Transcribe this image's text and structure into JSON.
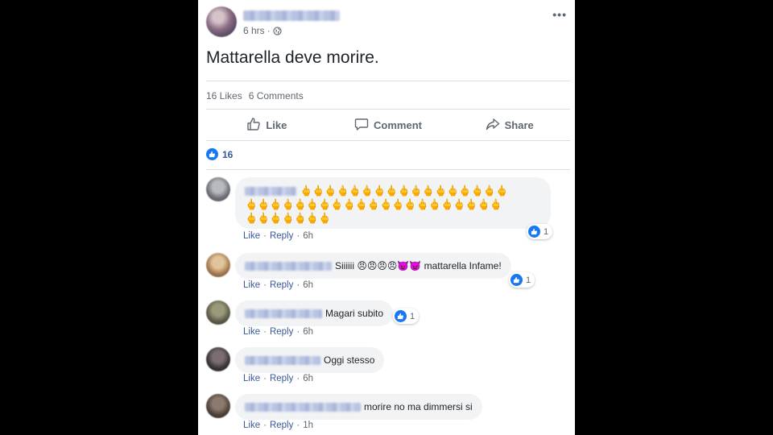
{
  "post": {
    "timestamp": "6 hrs",
    "separator": "·",
    "more_label": "•••",
    "text": "Mattarella deve morire.",
    "likes": "16 Likes",
    "comments_count": "6 Comments",
    "actions": {
      "like": "Like",
      "comment": "Comment",
      "share": "Share"
    },
    "reaction_total": "16",
    "colors": {
      "link": "#385898",
      "like_blue": "#1877f2",
      "bubble": "#f2f3f5",
      "meta": "#606770"
    }
  },
  "comments": [
    {
      "emoji_line1": "🖕🖕🖕🖕🖕🖕🖕🖕🖕🖕🖕🖕🖕🖕🖕🖕🖕",
      "emoji_line2": "🖕🖕🖕🖕🖕🖕🖕🖕🖕🖕🖕🖕🖕🖕🖕🖕🖕🖕🖕🖕🖕",
      "emoji_line3": "🖕🖕🖕🖕🖕🖕🖕",
      "like": "Like",
      "reply": "Reply",
      "time": "6h",
      "reactions": "1"
    },
    {
      "text_prefix": "Siiiiii",
      "emojis": "😠😠😠😠👿👿",
      "text_suffix": "mattarella Infame!",
      "like": "Like",
      "reply": "Reply",
      "time": "6h",
      "reactions": "1"
    },
    {
      "text": "Magari subito",
      "like": "Like",
      "reply": "Reply",
      "time": "6h",
      "reactions": "1"
    },
    {
      "text": "Oggi stesso",
      "like": "Like",
      "reply": "Reply",
      "time": "6h"
    },
    {
      "text": "morire no ma dimmersi si",
      "like": "Like",
      "reply": "Reply",
      "time": "1h"
    }
  ]
}
